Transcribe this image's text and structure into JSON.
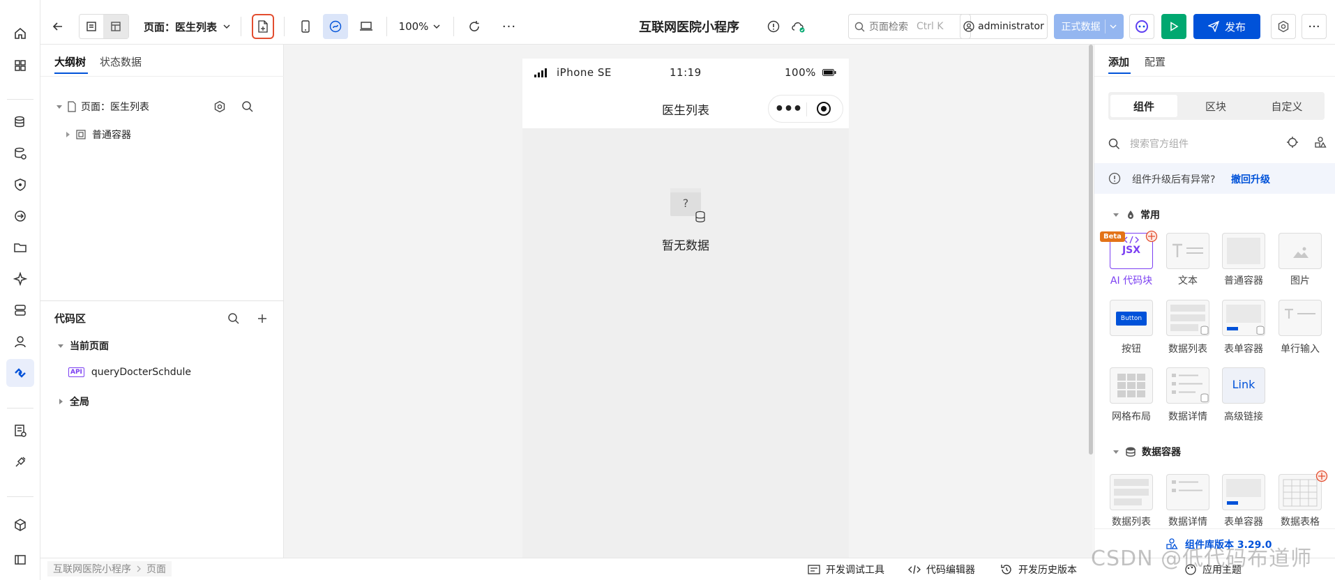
{
  "topbar": {
    "page_selector": "页面：医生列表",
    "zoom": "100%",
    "app_title": "互联网医院小程序",
    "search_placeholder": "页面检索",
    "search_shortcut": "Ctrl K",
    "user": "administrator",
    "env_label": "正式数据",
    "publish_label": "发布"
  },
  "left": {
    "tabs": [
      "大纲树",
      "状态数据"
    ],
    "tree_root": "页面：医生列表",
    "tree_child": "普通容器",
    "code_title": "代码区",
    "current_page": "当前页面",
    "api_badge": "API",
    "api_name": "queryDocterSchdule",
    "global": "全局"
  },
  "phone": {
    "carrier": "iPhone SE",
    "time": "11:19",
    "battery": "100%",
    "nav_title": "医生列表",
    "empty_text": "暂无数据",
    "placeholder_glyph": "?"
  },
  "right": {
    "tabs": [
      "添加",
      "配置"
    ],
    "seg": [
      "组件",
      "区块",
      "自定义"
    ],
    "search_placeholder": "搜索官方组件",
    "notice": "组件升级后有异常?",
    "notice_link": "撤回升级",
    "group_common": "常用",
    "beta": "Beta",
    "jsx": "JSX",
    "button_inner": "Button",
    "link_inner": "Link",
    "components": [
      "AI 代码块",
      "文本",
      "普通容器",
      "图片",
      "按钮",
      "数据列表",
      "表单容器",
      "单行输入",
      "网格布局",
      "数据详情",
      "高级链接"
    ],
    "group_data": "数据容器",
    "data_components": [
      "数据列表",
      "数据详情",
      "表单容器",
      "数据表格"
    ],
    "lib_version": "组件库版本 3.29.0"
  },
  "bottom": {
    "breadcrumb": [
      "互联网医院小程序",
      "页面"
    ],
    "dev_tools": "开发调试工具",
    "code_editor": "代码编辑器",
    "history": "开发历史版本",
    "theme": "应用主题"
  },
  "watermark": "CSDN @低代码布道师",
  "colors": {
    "primary": "#0052d9",
    "run": "#00a870",
    "beta": "#e37318",
    "ai": "#7b3ff2",
    "highlight": "#e34d2f"
  }
}
